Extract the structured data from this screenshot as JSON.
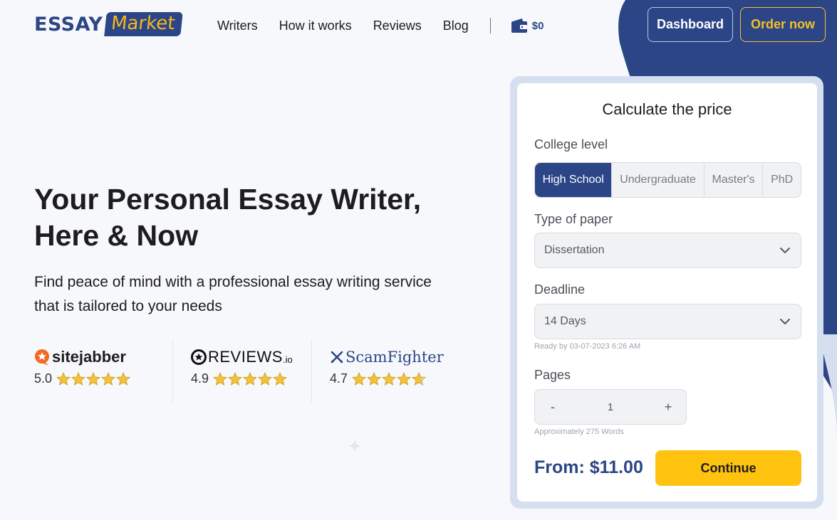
{
  "brand": {
    "logo_part1": "ESSAY",
    "logo_part2": "Market"
  },
  "nav": {
    "items": [
      "Writers",
      "How it works",
      "Reviews",
      "Blog"
    ],
    "wallet_amount": "$0",
    "dashboard_label": "Dashboard",
    "order_label": "Order now"
  },
  "hero": {
    "title_line1": "Your Personal Essay Writer,",
    "title_line2": "Here & Now",
    "subtitle_line1": "Find peace of mind with a professional essay writing service",
    "subtitle_line2": "that is tailored to your needs"
  },
  "ratings": [
    {
      "brand": "sitejabber",
      "score": "5.0",
      "stars": 5
    },
    {
      "brand": "REVIEWS",
      "brand_suffix": ".io",
      "score": "4.9",
      "stars": 5
    },
    {
      "brand": "ScamFighter",
      "score": "4.7",
      "stars": 4.7
    }
  ],
  "calculator": {
    "title": "Calculate the price",
    "college_level_label": "College level",
    "levels": [
      "High School",
      "Undergraduate",
      "Master's",
      "PhD"
    ],
    "active_level": "High School",
    "paper_type_label": "Type of paper",
    "paper_type_value": "Dissertation",
    "deadline_label": "Deadline",
    "deadline_value": "14 Days",
    "ready_by": "Ready by 03-07-2023 6:26 AM",
    "pages_label": "Pages",
    "pages_minus": "-",
    "pages_value": "1",
    "pages_plus": "+",
    "words_hint": "Approximately 275 Words",
    "price_prefix": "From:",
    "price_value": "$11.00",
    "continue_label": "Continue"
  },
  "colors": {
    "brand_blue": "#2b4587",
    "accent_yellow": "#ffc20e",
    "star_gold": "#f3c13a"
  },
  "icons": [
    "wallet-icon",
    "chevron-down-icon",
    "star-icon",
    "sitejabber-logo-icon",
    "reviews-io-logo-icon",
    "scamfighter-logo-icon",
    "sparkle-icon"
  ]
}
